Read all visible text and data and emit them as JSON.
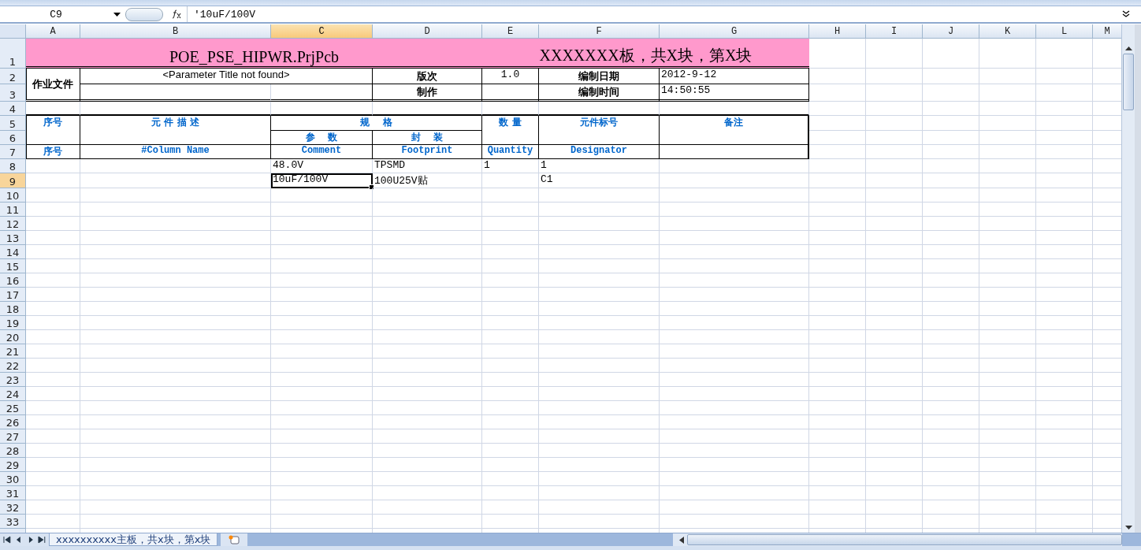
{
  "formula_bar": {
    "name_box": "C9",
    "formula": "'10uF/100V"
  },
  "columns": [
    {
      "label": "A",
      "selected": false
    },
    {
      "label": "B",
      "selected": false
    },
    {
      "label": "C",
      "selected": true
    },
    {
      "label": "D",
      "selected": false
    },
    {
      "label": "E",
      "selected": false
    },
    {
      "label": "F",
      "selected": false
    },
    {
      "label": "G",
      "selected": false
    },
    {
      "label": "H",
      "selected": false
    },
    {
      "label": "I",
      "selected": false
    },
    {
      "label": "J",
      "selected": false
    },
    {
      "label": "K",
      "selected": false
    },
    {
      "label": "L",
      "selected": false
    },
    {
      "label": "M",
      "selected": false
    }
  ],
  "rows": [
    {
      "header": "1",
      "selected": false,
      "cells": [
        {
          "text": "POE_PSE_HIPWR.PrjPcb",
          "kind": "title",
          "selected": false
        },
        {
          "text": "XXXXXXX板，共X块，第X块",
          "kind": "title",
          "selected": false
        }
      ]
    },
    {
      "header": "2",
      "selected": false,
      "cells": [
        {
          "text": "作业文件",
          "kind": "label",
          "selected": false
        },
        {
          "text": "<Parameter Title not found>",
          "kind": "note",
          "selected": false
        },
        {
          "text": "版次",
          "kind": "label",
          "selected": false
        },
        {
          "text": "1.0",
          "kind": "value",
          "selected": false
        },
        {
          "text": "编制日期",
          "kind": "label",
          "selected": false
        },
        {
          "text": "2012-9-12",
          "kind": "value",
          "selected": false
        }
      ]
    },
    {
      "header": "3",
      "selected": false,
      "cells": [
        {
          "text": "制作",
          "kind": "label",
          "selected": false
        },
        {
          "text": "编制时间",
          "kind": "label",
          "selected": false
        },
        {
          "text": "14:50:55",
          "kind": "value",
          "selected": false
        }
      ]
    },
    {
      "header": "4",
      "selected": false,
      "cells": []
    },
    {
      "header": "5",
      "selected": false,
      "cells": [
        {
          "text": "序号",
          "kind": "header",
          "selected": false
        },
        {
          "text": "元 件 描 述",
          "kind": "header",
          "selected": false
        },
        {
          "text": "规　 格",
          "kind": "header",
          "selected": false
        },
        {
          "text": "数 量",
          "kind": "header",
          "selected": false
        },
        {
          "text": "元件标号",
          "kind": "header",
          "selected": false
        },
        {
          "text": "备注",
          "kind": "header",
          "selected": false
        }
      ]
    },
    {
      "header": "6",
      "selected": false,
      "cells": [
        {
          "text": "参　 数",
          "kind": "header",
          "selected": false
        },
        {
          "text": "封　 装",
          "kind": "header",
          "selected": false
        }
      ]
    },
    {
      "header": "7",
      "selected": false,
      "cells": [
        {
          "text": "序号",
          "kind": "header",
          "selected": false
        },
        {
          "text": "#Column Name",
          "kind": "field",
          "selected": false
        },
        {
          "text": "Comment",
          "kind": "field",
          "selected": false
        },
        {
          "text": "Footprint",
          "kind": "field",
          "selected": false
        },
        {
          "text": "Quantity",
          "kind": "field",
          "selected": false
        },
        {
          "text": "Designator",
          "kind": "field",
          "selected": false
        }
      ]
    },
    {
      "header": "8",
      "selected": false,
      "cells": [
        {
          "text": "48.0V",
          "kind": "value",
          "selected": false
        },
        {
          "text": "TPSMD",
          "kind": "value",
          "selected": false
        },
        {
          "text": "1",
          "kind": "value",
          "selected": false
        },
        {
          "text": "1",
          "kind": "value",
          "selected": false
        }
      ]
    },
    {
      "header": "9",
      "selected": true,
      "cells": [
        {
          "text": "10uF/100V",
          "kind": "value",
          "selected": true
        },
        {
          "text": "100U25V贴",
          "kind": "value",
          "selected": false
        },
        {
          "text": "C1",
          "kind": "value",
          "selected": false
        }
      ]
    },
    {
      "header": "10",
      "selected": false,
      "cells": []
    },
    {
      "header": "11",
      "selected": false,
      "cells": []
    },
    {
      "header": "12",
      "selected": false,
      "cells": []
    },
    {
      "header": "13",
      "selected": false,
      "cells": []
    },
    {
      "header": "14",
      "selected": false,
      "cells": []
    },
    {
      "header": "15",
      "selected": false,
      "cells": []
    },
    {
      "header": "16",
      "selected": false,
      "cells": []
    },
    {
      "header": "17",
      "selected": false,
      "cells": []
    },
    {
      "header": "18",
      "selected": false,
      "cells": []
    },
    {
      "header": "19",
      "selected": false,
      "cells": []
    },
    {
      "header": "20",
      "selected": false,
      "cells": []
    },
    {
      "header": "21",
      "selected": false,
      "cells": []
    },
    {
      "header": "22",
      "selected": false,
      "cells": []
    },
    {
      "header": "23",
      "selected": false,
      "cells": []
    },
    {
      "header": "24",
      "selected": false,
      "cells": []
    },
    {
      "header": "25",
      "selected": false,
      "cells": []
    },
    {
      "header": "26",
      "selected": false,
      "cells": []
    },
    {
      "header": "27",
      "selected": false,
      "cells": []
    },
    {
      "header": "28",
      "selected": false,
      "cells": []
    },
    {
      "header": "29",
      "selected": false,
      "cells": []
    },
    {
      "header": "30",
      "selected": false,
      "cells": []
    },
    {
      "header": "31",
      "selected": false,
      "cells": []
    },
    {
      "header": "32",
      "selected": false,
      "cells": []
    },
    {
      "header": "33",
      "selected": false,
      "cells": []
    }
  ],
  "sheet_tabs": [
    {
      "label": "xxxxxxxxxx主板，共x块，第x块",
      "selected": true
    }
  ]
}
